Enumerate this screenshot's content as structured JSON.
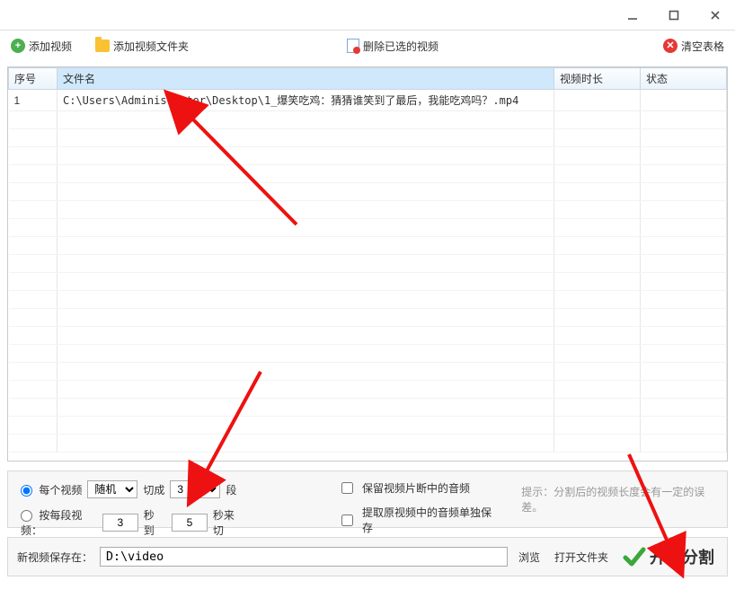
{
  "toolbar": {
    "add_video": "添加视频",
    "add_folder": "添加视频文件夹",
    "delete_selected": "删除已选的视频",
    "clear_table": "清空表格"
  },
  "table": {
    "headers": {
      "index": "序号",
      "filename": "文件名",
      "duration": "视频时长",
      "status": "状态"
    },
    "rows": [
      {
        "index": "1",
        "filename": "C:\\Users\\Administrator\\Desktop\\1_爆笑吃鸡：猜猜谁笑到了最后，我能吃鸡吗？.mp4",
        "duration": "",
        "status": ""
      }
    ]
  },
  "options": {
    "radio_per_video_label": "每个视频",
    "random_select_options": [
      "随机"
    ],
    "random_select_value": "随机",
    "cut_into_label": "切成",
    "segments_value": "3",
    "segments_suffix": "段",
    "radio_per_segment_label": "按每段视频：",
    "sec_from_value": "3",
    "sec_mid_label": "秒 到",
    "sec_to_value": "5",
    "sec_suffix": "秒来切",
    "keep_audio_label": "保留视频片断中的音频",
    "extract_audio_label": "提取原视频中的音频单独保存",
    "hint_text": "提示：分割后的视频长度会有一定的误差。"
  },
  "savebar": {
    "label": "新视频保存在：",
    "path_value": "D:\\video",
    "browse": "浏览",
    "open_folder": "打开文件夹",
    "start": "开始分割"
  }
}
